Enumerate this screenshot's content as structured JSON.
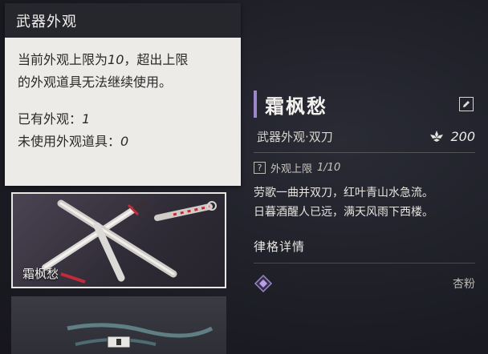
{
  "tooltip": {
    "title": "武器外观",
    "line1_a": "当前外观上限为",
    "line1_num": "10",
    "line1_b": "，超出上限",
    "line2": "的外观道具无法继续使用。",
    "owned_label": "已有外观：",
    "owned_value": "1",
    "unused_label": "未使用外观道具：",
    "unused_value": "0"
  },
  "cards": {
    "selected_name": "霜枫愁"
  },
  "detail": {
    "title": "霜枫愁",
    "type": "武器外观·双刀",
    "price": "200",
    "limit_label": "外观上限",
    "limit_value": "1/10",
    "poem_line1": "劳歌一曲并双刀，红叶青山水急流。",
    "poem_line2": "日暮酒醒人已远，满天风雨下西楼。",
    "section_title": "律格详情",
    "attribute_value": "杏粉"
  },
  "colors": {
    "accent": "#9a86c8",
    "panel_light": "#ecebe8",
    "panel_dark": "#26262d",
    "background": "#1d1e26"
  },
  "icons": {
    "edit": "pencil-icon",
    "currency": "lotus-currency-icon",
    "help": "question-icon",
    "attribute": "purple-diamond-icon"
  }
}
